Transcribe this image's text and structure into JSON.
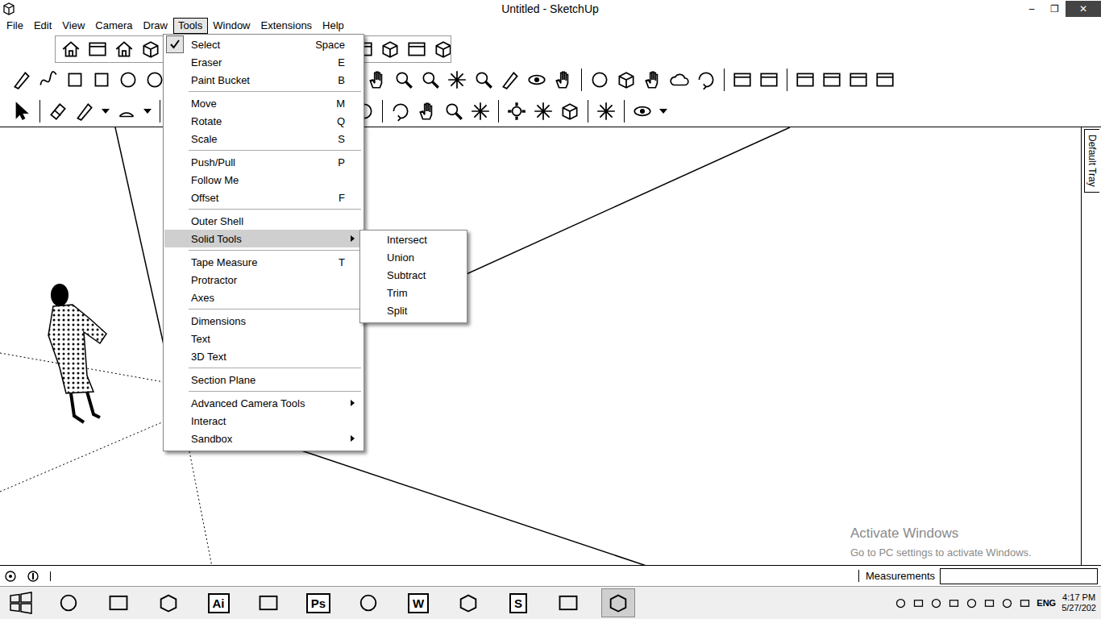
{
  "window": {
    "title": "Untitled - SketchUp",
    "controls": [
      "–",
      "❐",
      "✕"
    ]
  },
  "menubar": [
    {
      "label": "File",
      "selected": false
    },
    {
      "label": "Edit",
      "selected": false
    },
    {
      "label": "View",
      "selected": false
    },
    {
      "label": "Camera",
      "selected": false
    },
    {
      "label": "Draw",
      "selected": false
    },
    {
      "label": "Tools",
      "selected": true
    },
    {
      "label": "Window",
      "selected": false
    },
    {
      "label": "Extensions",
      "selected": false
    },
    {
      "label": "Help",
      "selected": false
    }
  ],
  "tools_menu": {
    "groups": [
      [
        {
          "label": "Select",
          "shortcut": "Space",
          "checked": true,
          "submenu": false,
          "highlighted": false
        },
        {
          "label": "Eraser",
          "shortcut": "E",
          "checked": false,
          "submenu": false,
          "highlighted": false
        },
        {
          "label": "Paint Bucket",
          "shortcut": "B",
          "checked": false,
          "submenu": false,
          "highlighted": false
        }
      ],
      [
        {
          "label": "Move",
          "shortcut": "M",
          "checked": false,
          "submenu": false,
          "highlighted": false
        },
        {
          "label": "Rotate",
          "shortcut": "Q",
          "checked": false,
          "submenu": false,
          "highlighted": false
        },
        {
          "label": "Scale",
          "shortcut": "S",
          "checked": false,
          "submenu": false,
          "highlighted": false
        }
      ],
      [
        {
          "label": "Push/Pull",
          "shortcut": "P",
          "checked": false,
          "submenu": false,
          "highlighted": false
        },
        {
          "label": "Follow Me",
          "shortcut": "",
          "checked": false,
          "submenu": false,
          "highlighted": false
        },
        {
          "label": "Offset",
          "shortcut": "F",
          "checked": false,
          "submenu": false,
          "highlighted": false
        }
      ],
      [
        {
          "label": "Outer Shell",
          "shortcut": "",
          "checked": false,
          "submenu": false,
          "highlighted": false
        },
        {
          "label": "Solid Tools",
          "shortcut": "",
          "checked": false,
          "submenu": true,
          "highlighted": true
        }
      ],
      [
        {
          "label": "Tape Measure",
          "shortcut": "T",
          "checked": false,
          "submenu": false,
          "highlighted": false
        },
        {
          "label": "Protractor",
          "shortcut": "",
          "checked": false,
          "submenu": false,
          "highlighted": false
        },
        {
          "label": "Axes",
          "shortcut": "",
          "checked": false,
          "submenu": false,
          "highlighted": false
        }
      ],
      [
        {
          "label": "Dimensions",
          "shortcut": "",
          "checked": false,
          "submenu": false,
          "highlighted": false
        },
        {
          "label": "Text",
          "shortcut": "",
          "checked": false,
          "submenu": false,
          "highlighted": false
        },
        {
          "label": "3D Text",
          "shortcut": "",
          "checked": false,
          "submenu": false,
          "highlighted": false
        }
      ],
      [
        {
          "label": "Section Plane",
          "shortcut": "",
          "checked": false,
          "submenu": false,
          "highlighted": false
        }
      ],
      [
        {
          "label": "Advanced Camera Tools",
          "shortcut": "",
          "checked": false,
          "submenu": true,
          "highlighted": false
        },
        {
          "label": "Interact",
          "shortcut": "",
          "checked": false,
          "submenu": false,
          "highlighted": false
        },
        {
          "label": "Sandbox",
          "shortcut": "",
          "checked": false,
          "submenu": true,
          "highlighted": false
        }
      ]
    ]
  },
  "solid_tools_submenu": [
    {
      "label": "Intersect",
      "highlighted": false
    },
    {
      "label": "Union",
      "highlighted": false
    },
    {
      "label": "Subtract",
      "highlighted": false
    },
    {
      "label": "Trim",
      "highlighted": false
    },
    {
      "label": "Split",
      "highlighted": false
    }
  ],
  "tray": {
    "label": "Default Tray"
  },
  "watermark": {
    "title": "Activate Windows",
    "subtitle": "Go to PC settings to activate Windows."
  },
  "status_bar": {
    "measurements_label": "Measurements",
    "measurements_value": ""
  },
  "taskbar": {
    "apps": [
      {
        "label": "",
        "active": false
      },
      {
        "label": "",
        "active": false
      },
      {
        "label": "",
        "active": false
      },
      {
        "label": "Ai",
        "active": false
      },
      {
        "label": "",
        "active": false
      },
      {
        "label": "Ps",
        "active": false
      },
      {
        "label": "",
        "active": false
      },
      {
        "label": "W",
        "active": false
      },
      {
        "label": "",
        "active": false
      },
      {
        "label": "S",
        "active": false
      },
      {
        "label": "",
        "active": false
      },
      {
        "label": "",
        "active": true
      }
    ],
    "language": "ENG",
    "time": "4:17 PM",
    "date": "5/27/202"
  }
}
